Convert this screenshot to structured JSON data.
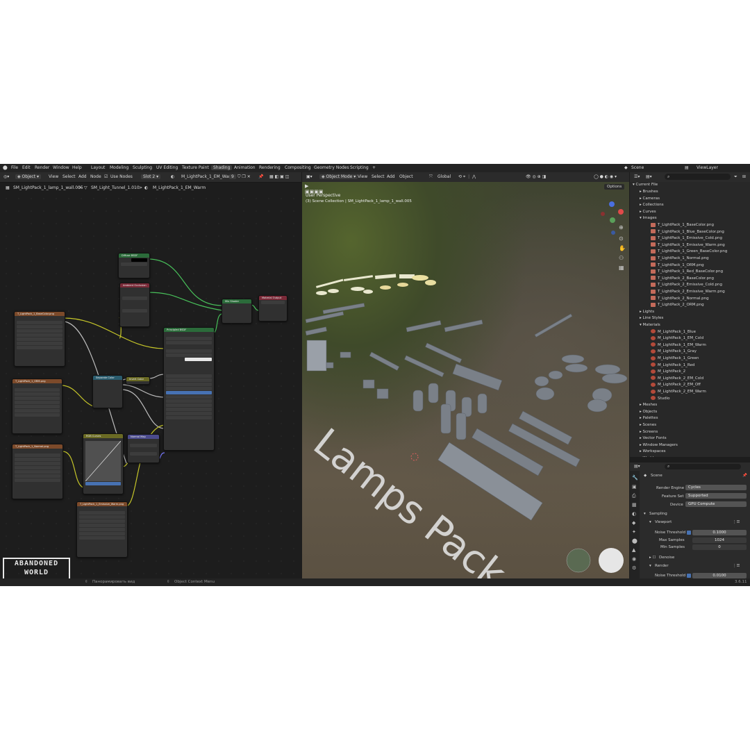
{
  "topbar": {
    "menus": [
      "File",
      "Edit",
      "Render",
      "Window",
      "Help"
    ],
    "workspaces": [
      "Layout",
      "Modeling",
      "Sculpting",
      "UV Editing",
      "Texture Paint",
      "Shading",
      "Animation",
      "Rendering",
      "Compositing",
      "Geometry Nodes",
      "Scripting"
    ],
    "active_workspace": "Shading",
    "add_tab": "+",
    "scene": "Scene",
    "view_layer": "ViewLayer"
  },
  "node_editor": {
    "mode": "Object",
    "menus": [
      "View",
      "Select",
      "Add",
      "Node"
    ],
    "use_nodes": "Use Nodes",
    "slot": "Slot 2",
    "material": "M_LightPack_1_EM_Warm",
    "user_count": "9",
    "breadcrumb": [
      "SM_LightPack_1_lamp_1_wall.005",
      "SM_Light_Tunnel_1.010",
      "M_LightPack_1_EM_Warm"
    ],
    "nodes": {
      "diffuse": "Diffuse BSDF",
      "ao": "Ambient Occlusion",
      "mix": "Mix Shader",
      "output": "Material Output",
      "principled": "Principled BSDF",
      "separate": "Separate Color",
      "invert": "Invert Color",
      "normal_map": "Normal Map",
      "rgb_curves": "RGB Curves",
      "tex1": "T_LightPack_1_BaseColor.png",
      "tex2": "T_LightPack_1_ORM.png",
      "tex3": "T_LightPack_1_Normal.png",
      "tex4": "T_LightPack_1_Emissive_Warm.png"
    }
  },
  "logo": {
    "line1": "ABANDONED",
    "line2": "WORLD"
  },
  "status": {
    "pan": "Панорамировать вид",
    "context": "Object Context Menu",
    "version": "3.6.11"
  },
  "viewport": {
    "mode": "Object Mode",
    "menus": [
      "View",
      "Select",
      "Add",
      "Object"
    ],
    "transform": "Global",
    "options": "Options",
    "perspective": "User Perspective",
    "collection": "(3) Scene Collection | SM_LightPack_1_lamp_1_wall.005",
    "watermark": "Lamps Pack"
  },
  "outliner": {
    "root": "Current File",
    "search": "",
    "items": [
      {
        "label": "Brushes",
        "kind": "cat"
      },
      {
        "label": "Cameras",
        "kind": "cat"
      },
      {
        "label": "Collections",
        "kind": "cat"
      },
      {
        "label": "Curves",
        "kind": "cat"
      },
      {
        "label": "Images",
        "kind": "open"
      },
      {
        "label": "T_LightPack_1_BaseColor.png",
        "kind": "img"
      },
      {
        "label": "T_LightPack_1_Blue_BaseColor.png",
        "kind": "img"
      },
      {
        "label": "T_LightPack_1_Emissive_Cold.png",
        "kind": "img"
      },
      {
        "label": "T_LightPack_1_Emissive_Warm.png",
        "kind": "img"
      },
      {
        "label": "T_LightPack_1_Green_BaseColor.png",
        "kind": "img"
      },
      {
        "label": "T_LightPack_1_Normal.png",
        "kind": "img"
      },
      {
        "label": "T_LightPack_1_ORM.png",
        "kind": "img"
      },
      {
        "label": "T_LightPack_1_Red_BaseColor.png",
        "kind": "img"
      },
      {
        "label": "T_LightPack_2_BaseColor.png",
        "kind": "img"
      },
      {
        "label": "T_LightPack_2_Emissive_Cold.png",
        "kind": "img"
      },
      {
        "label": "T_LightPack_2_Emissive_Warm.png",
        "kind": "img"
      },
      {
        "label": "T_LightPack_2_Normal.png",
        "kind": "img"
      },
      {
        "label": "T_LightPack_2_ORM.png",
        "kind": "img"
      },
      {
        "label": "Lights",
        "kind": "cat"
      },
      {
        "label": "Line Styles",
        "kind": "cat"
      },
      {
        "label": "Materials",
        "kind": "open"
      },
      {
        "label": "M_LightPack_1_Blue",
        "kind": "mat"
      },
      {
        "label": "M_LightPack_1_EM_Cold",
        "kind": "mat"
      },
      {
        "label": "M_LightPack_1_EM_Warm",
        "kind": "mat"
      },
      {
        "label": "M_LightPack_1_Gray",
        "kind": "mat"
      },
      {
        "label": "M_LightPack_1_Green",
        "kind": "mat"
      },
      {
        "label": "M_LightPack_1_Red",
        "kind": "mat"
      },
      {
        "label": "M_LightPack_2",
        "kind": "mat"
      },
      {
        "label": "M_LightPack_2_EM_Cold",
        "kind": "mat"
      },
      {
        "label": "M_LightPack_2_EM_Off",
        "kind": "mat"
      },
      {
        "label": "M_LightPack_2_EM_Warm",
        "kind": "mat"
      },
      {
        "label": "Studio",
        "kind": "mat"
      },
      {
        "label": "Meshes",
        "kind": "cat"
      },
      {
        "label": "Objects",
        "kind": "cat"
      },
      {
        "label": "Palettes",
        "kind": "cat"
      },
      {
        "label": "Scenes",
        "kind": "cat"
      },
      {
        "label": "Screens",
        "kind": "cat"
      },
      {
        "label": "Vector Fonts",
        "kind": "cat"
      },
      {
        "label": "Window Managers",
        "kind": "cat"
      },
      {
        "label": "Workspaces",
        "kind": "cat"
      },
      {
        "label": "Worlds",
        "kind": "cat"
      }
    ]
  },
  "properties": {
    "context": "Scene",
    "render_engine_label": "Render Engine",
    "render_engine": "Cycles",
    "feature_set_label": "Feature Set",
    "feature_set": "Supported",
    "device_label": "Device",
    "device": "GPU Compute",
    "sampling": "Sampling",
    "viewport": "Viewport",
    "noise_threshold_label": "Noise Threshold",
    "noise_threshold": "0.1000",
    "max_samples_label": "Max Samples",
    "max_samples": "1024",
    "min_samples_label": "Min Samples",
    "min_samples": "0",
    "denoise": "Denoise",
    "render": "Render",
    "render_noise_threshold": "0.0100"
  }
}
